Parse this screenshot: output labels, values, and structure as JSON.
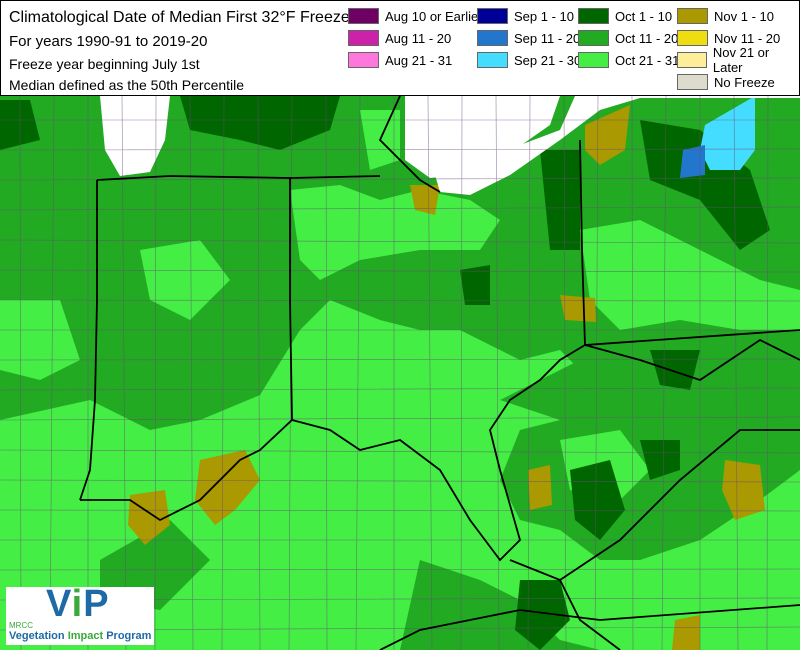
{
  "header": {
    "title": "Climatological Date of Median First 32°F Freeze",
    "period": "For years 1990-91 to 2019-20",
    "freeze_year": "Freeze year beginning July 1st",
    "median_note": "Median defined as the 50th Percentile"
  },
  "legend": [
    {
      "label": "Aug 10 or Earlier",
      "color": "#6e0064"
    },
    {
      "label": "Aug 11 - 20",
      "color": "#cc22aa"
    },
    {
      "label": "Aug 21 - 31",
      "color": "#ff77dd"
    },
    {
      "label": "Sep 1 - 10",
      "color": "#000099"
    },
    {
      "label": "Sep 11 - 20",
      "color": "#2277cc"
    },
    {
      "label": "Sep 21 - 30",
      "color": "#44ddff"
    },
    {
      "label": "Oct 1 - 10",
      "color": "#006600"
    },
    {
      "label": "Oct 11 - 20",
      "color": "#22aa22"
    },
    {
      "label": "Oct 21 - 31",
      "color": "#44ee44"
    },
    {
      "label": "Nov 1 - 10",
      "color": "#aa9900"
    },
    {
      "label": "Nov 11 - 20",
      "color": "#eedd11"
    },
    {
      "label": "Nov 21 or Later",
      "color": "#ffee99"
    },
    {
      "label": "No Freeze",
      "color": "#dddccc"
    }
  ],
  "logo": {
    "mrcc": "MRCC",
    "vip_v": "V",
    "vip_i": "i",
    "vip_p": "P",
    "program_a": "Vegetation ",
    "program_b": "Impact",
    "program_c": " Program"
  }
}
